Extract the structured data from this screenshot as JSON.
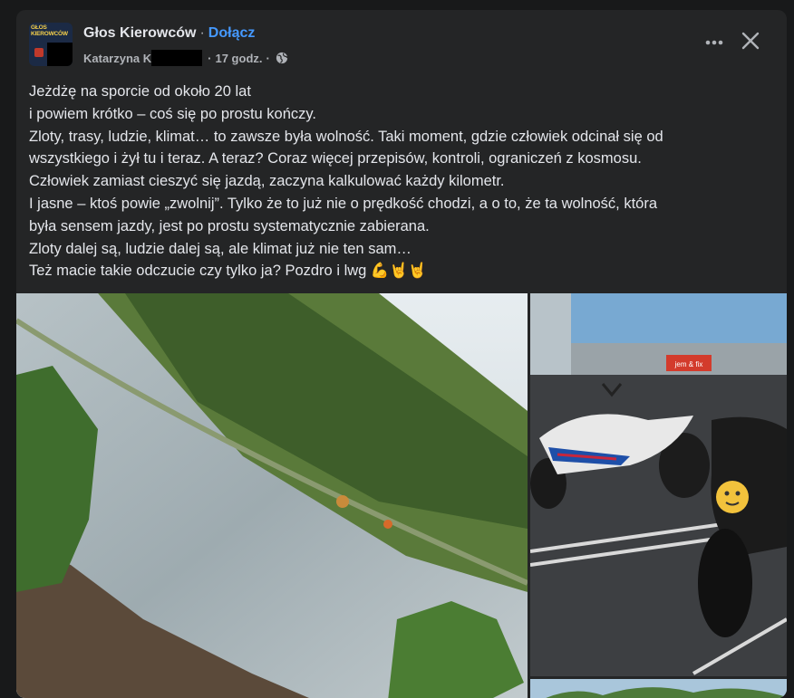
{
  "post": {
    "page_name": "Głos Kierowców",
    "separator": "·",
    "join_label": "Dołącz",
    "author": "Katarzyna K",
    "time": "17 godz.",
    "avatar_text": "GŁOS KIEROWCÓW",
    "lines": [
      "Jeżdżę na sporcie od około 20 lat",
      "i powiem krótko – coś się po prostu kończy.",
      "Zloty, trasy, ludzie, klimat… to zawsze była wolność. Taki moment, gdzie człowiek odcinał się od",
      "wszystkiego i żył tu i teraz. A teraz? Coraz więcej przepisów, kontroli, ograniczeń z kosmosu.",
      "Człowiek zamiast cieszyć się jazdą, zaczyna kalkulować każdy kilometr.",
      "I jasne – ktoś powie „zwolnij”. Tylko że to już nie o prędkość chodzi, a o to, że ta wolność, która",
      "była sensem jazdy, jest po prostu systematycznie zabierana.",
      "Zloty dalej są, ludzie dalej są, ale klimat już nie ten sam…",
      "Też macie takie odczucie czy tylko ja? Pozdro i lwg 💪🤘🤘"
    ],
    "store_sign": "jem & fix"
  },
  "colors": {
    "background": "#18191a",
    "card": "#242526",
    "text": "#e4e6eb",
    "secondary": "#b0b3b8",
    "link": "#4599ff"
  },
  "icons": {
    "more": "more-dots-icon",
    "close": "close-icon",
    "audience": "globe-icon"
  }
}
